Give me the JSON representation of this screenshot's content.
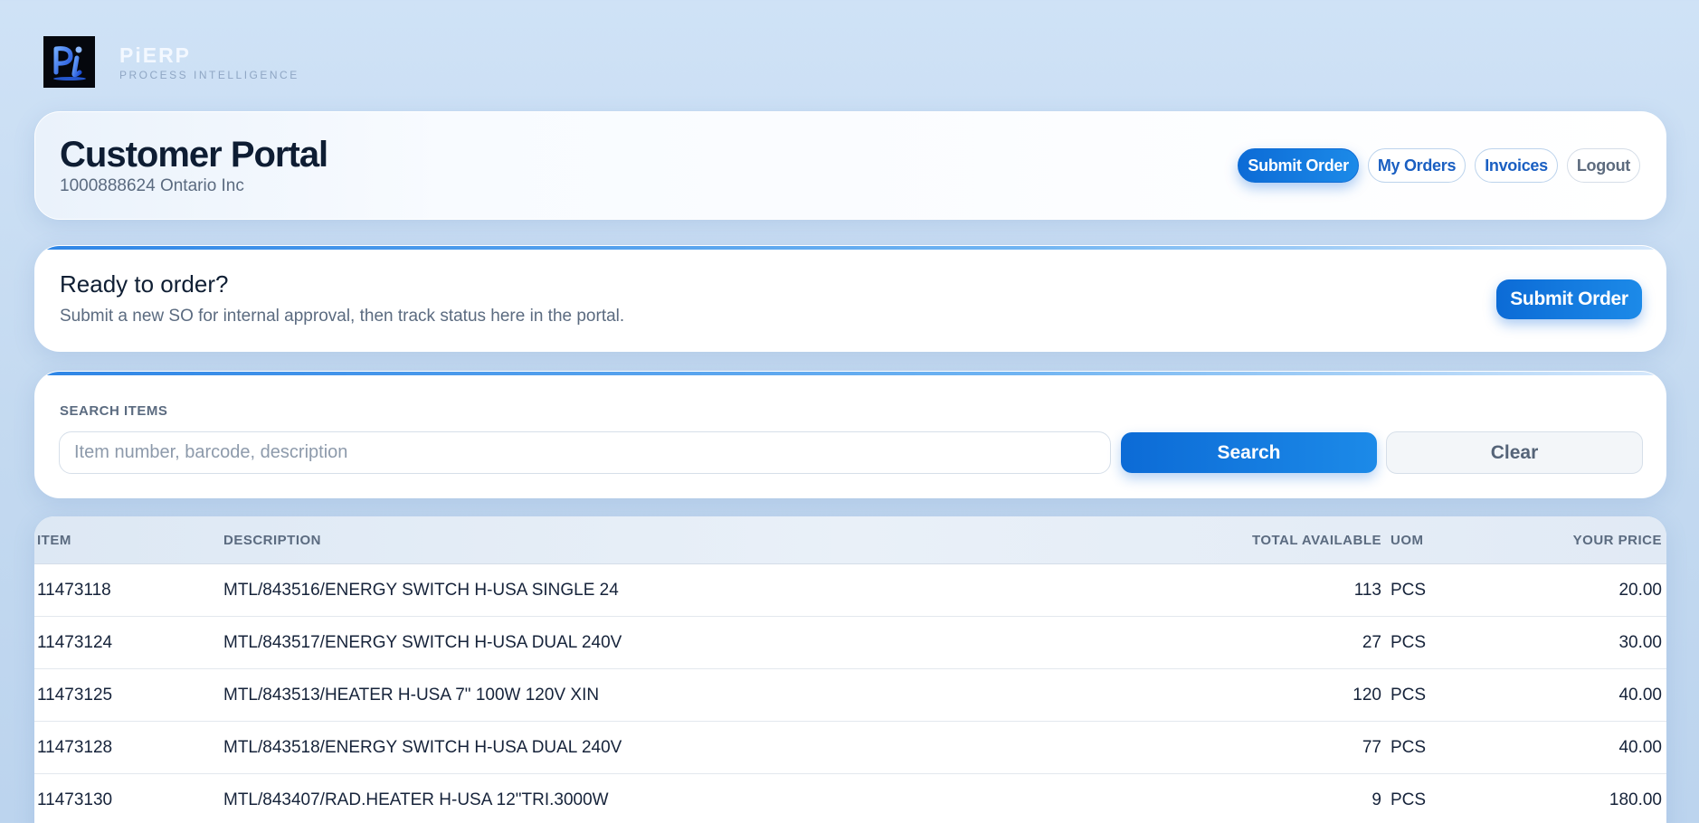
{
  "brand": {
    "name": "PiERP",
    "tagline": "PROCESS INTELLIGENCE",
    "logo_icon": "pi-logo-icon"
  },
  "header": {
    "title": "Customer Portal",
    "subtitle": "1000888624 Ontario Inc",
    "nav": {
      "submit_order": "Submit Order",
      "my_orders": "My Orders",
      "invoices": "Invoices",
      "logout": "Logout"
    }
  },
  "ready": {
    "title": "Ready to order?",
    "description": "Submit a new SO for internal approval, then track status here in the portal.",
    "button": "Submit Order"
  },
  "search": {
    "label": "SEARCH ITEMS",
    "placeholder": "Item number, barcode, description",
    "value": "",
    "search_button": "Search",
    "clear_button": "Clear"
  },
  "table": {
    "headers": {
      "item": "ITEM",
      "description": "DESCRIPTION",
      "total_available": "TOTAL AVAILABLE",
      "uom": "UOM",
      "your_price": "YOUR PRICE"
    },
    "rows": [
      {
        "item": "11473118",
        "description": "MTL/843516/ENERGY SWITCH H-USA SINGLE 24",
        "total_available": "113",
        "uom": "PCS",
        "price": "20.00"
      },
      {
        "item": "11473124",
        "description": "MTL/843517/ENERGY SWITCH H-USA DUAL 240V",
        "total_available": "27",
        "uom": "PCS",
        "price": "30.00"
      },
      {
        "item": "11473125",
        "description": "MTL/843513/HEATER H-USA 7\" 100W 120V XIN",
        "total_available": "120",
        "uom": "PCS",
        "price": "40.00"
      },
      {
        "item": "11473128",
        "description": "MTL/843518/ENERGY SWITCH H-USA DUAL 240V",
        "total_available": "77",
        "uom": "PCS",
        "price": "40.00"
      },
      {
        "item": "11473130",
        "description": "MTL/843407/RAD.HEATER H-USA 12\"TRI.3000W",
        "total_available": "9",
        "uom": "PCS",
        "price": "180.00"
      }
    ]
  },
  "colors": {
    "primary": "#0c6bd6",
    "background": "#cfe2f6",
    "text": "#12213a",
    "muted": "#5b6b80"
  }
}
